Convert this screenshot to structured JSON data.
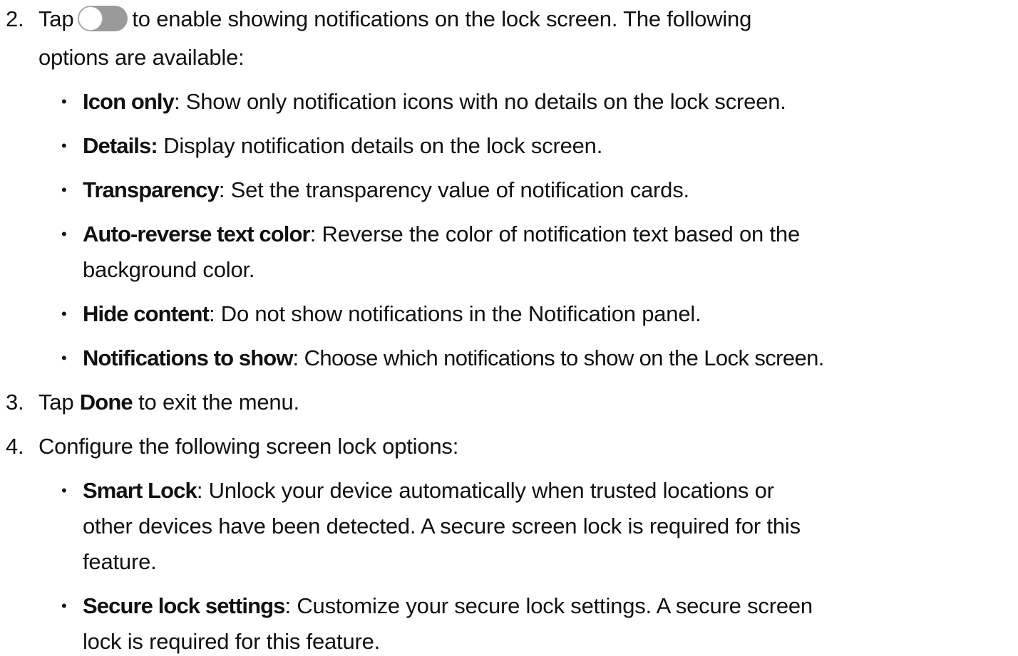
{
  "step2": {
    "number": "2.",
    "text_before": "Tap",
    "toggle_state": "off",
    "text_after": "to enable showing notifications on the lock screen. The following",
    "text_cont": "options are available:"
  },
  "step2_options": [
    {
      "term": "Icon only",
      "desc": ": Show only notification icons with no details on the lock screen."
    },
    {
      "term": "Details:",
      "desc": " Display notification details on the lock screen."
    },
    {
      "term": "Transparency",
      "desc": ": Set the transparency value of notification cards."
    },
    {
      "term": "Auto-reverse text color",
      "desc": ": Reverse the color of notification text based on the",
      "desc_cont": "background color."
    },
    {
      "term": "Hide content",
      "desc": ": Do not show notifications in the Notification panel."
    },
    {
      "term": "Notifications to show",
      "desc": ": Choose which notifications to show on the Lock screen."
    }
  ],
  "step3": {
    "number": "3.",
    "text_before": "Tap ",
    "term": "Done",
    "text_after": " to exit the menu."
  },
  "step4": {
    "number": "4.",
    "text": "Configure the following screen lock options:"
  },
  "step4_options": [
    {
      "term": "Smart Lock",
      "desc": ": Unlock your device automatically when trusted locations or",
      "desc_cont": "other devices have been detected. A secure screen lock is required for this",
      "desc_cont2": "feature."
    },
    {
      "term": "Secure lock settings",
      "desc": ": Customize your secure lock settings. A secure screen",
      "desc_cont": "lock is required for this feature."
    }
  ],
  "bullet_glyph": "•"
}
